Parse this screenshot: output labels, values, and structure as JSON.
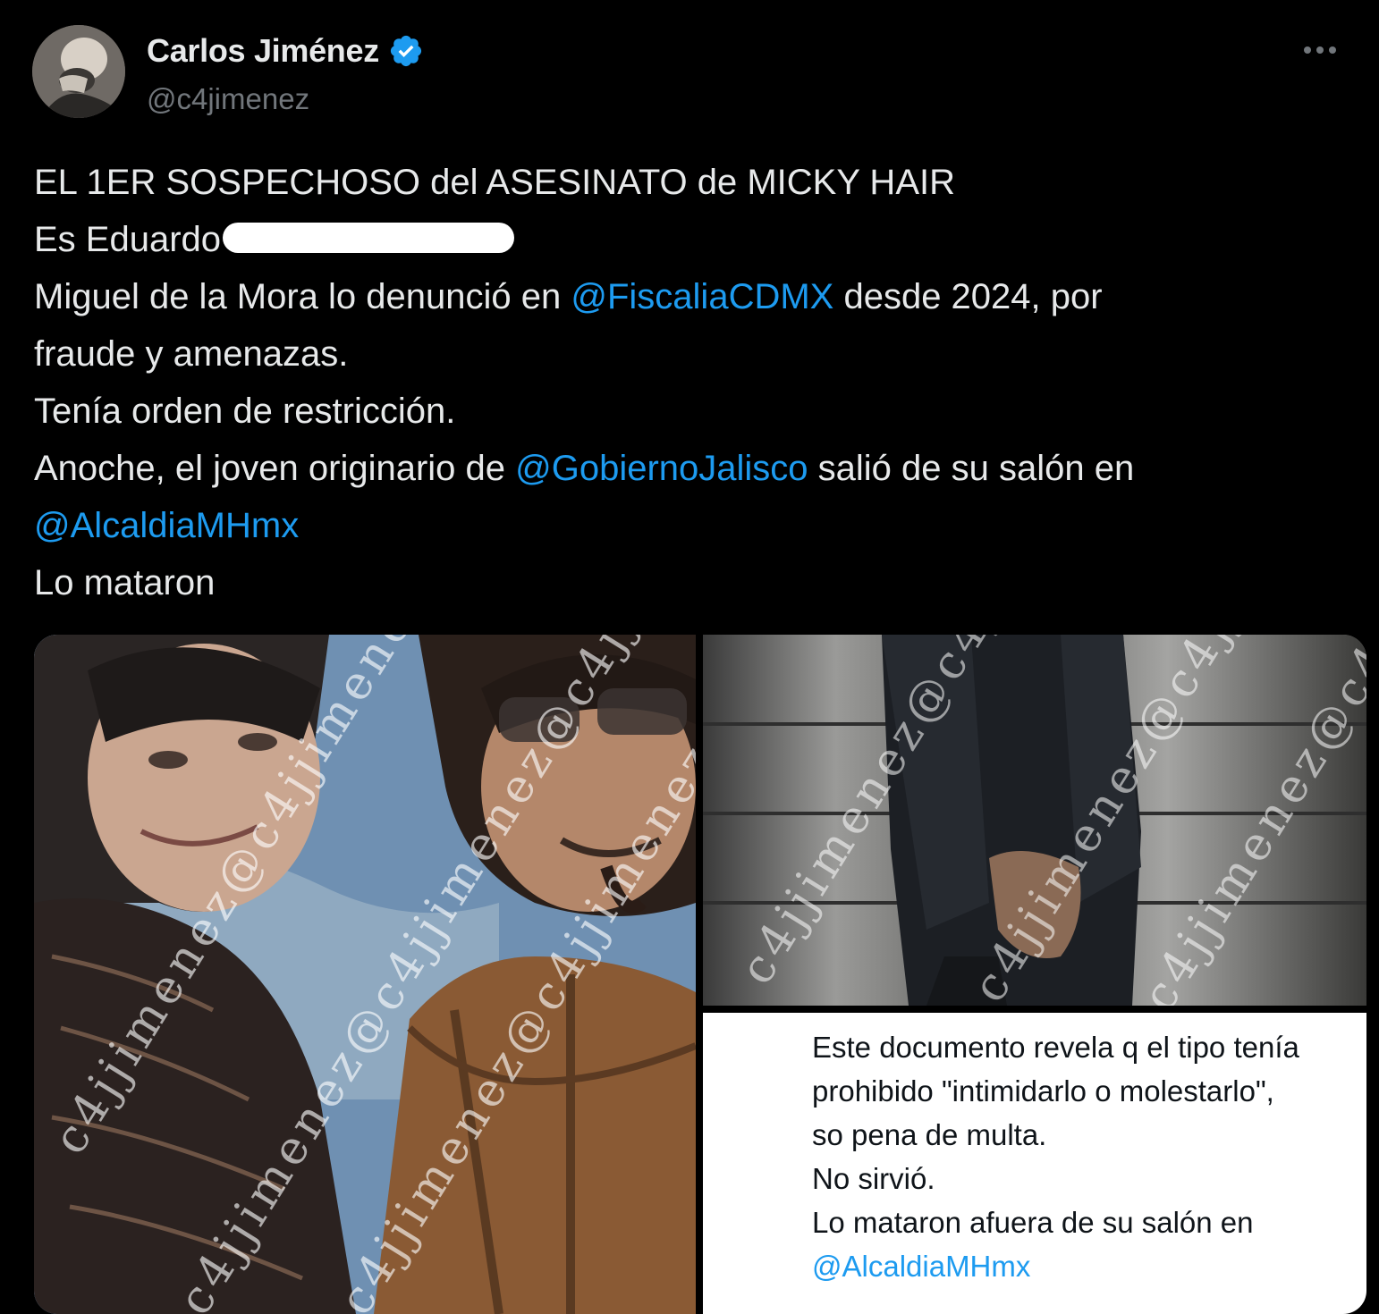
{
  "author": {
    "display_name": "Carlos Jiménez",
    "handle": "@c4jimenez",
    "verified_color": "#1d9bf0"
  },
  "tweet": {
    "line1": "EL 1ER  SOSPECHOSO del ASESINATO de MICKY HAIR",
    "line2_prefix": "Es Eduardo",
    "line3_before": "Miguel de la Mora lo denunció en ",
    "line3_mention": "@FiscaliaCDMX",
    "line3_after": " desde 2024, por",
    "line4": "fraude y amenazas.",
    "line5": "Tenía orden de restricción.",
    "line6_before": "Anoche, el joven originario de ",
    "line6_mention": "@GobiernoJalisco",
    "line6_after": " salió de su salón en",
    "line7_mention": "@AlcaldiaMHmx",
    "line8": "Lo mataron"
  },
  "media": {
    "watermark": "c4jjimenez@c4jjimenez@c4jjimenez",
    "document_lines": [
      "Este documento revela q el tipo tenía",
      "prohibido \"intimidarlo o molestarlo\",",
      "so pena de multa.",
      "No sirvió.",
      "Lo mataron afuera de su salón en"
    ],
    "document_mention": "@AlcaldiaMHmx"
  },
  "colors": {
    "background": "#000000",
    "text": "#e7e9ea",
    "secondary": "#71767b",
    "link": "#1d9bf0"
  }
}
